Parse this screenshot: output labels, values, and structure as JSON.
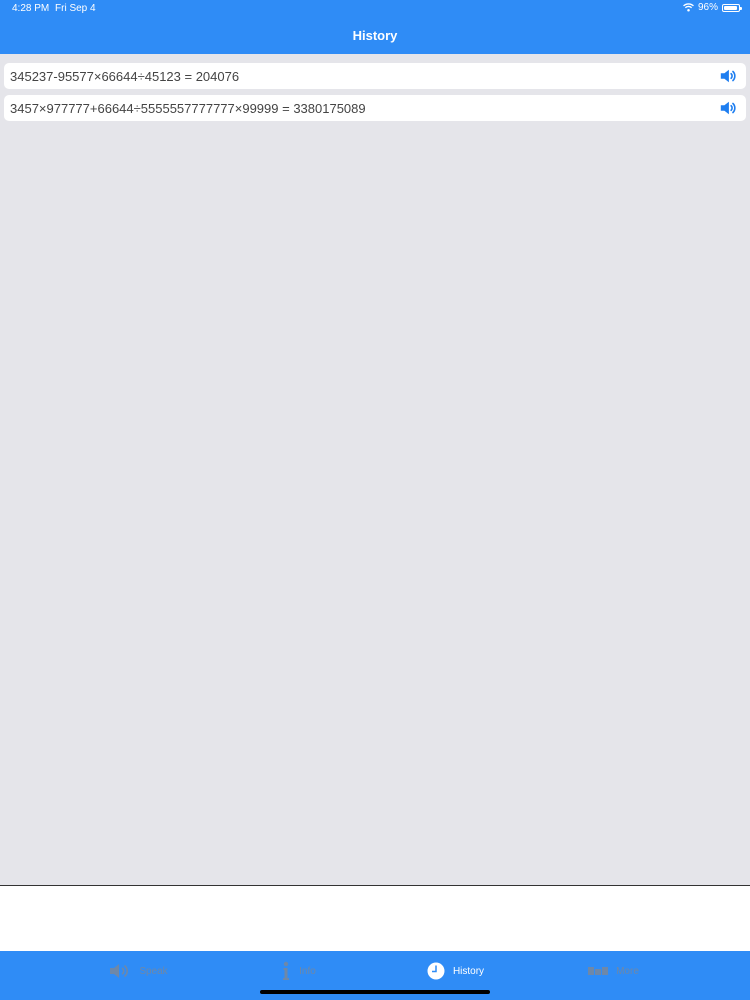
{
  "status_bar": {
    "time": "4:28 PM",
    "date": "Fri Sep 4",
    "battery": "96%",
    "battery_level": 0.96
  },
  "nav": {
    "title": "History"
  },
  "history": [
    {
      "expression": "345237-95577×66644÷45123 = 204076",
      "icon": "speaker-icon"
    },
    {
      "expression": "3457×977777+66644÷5555557777777×99999 = 3380175089",
      "icon": "speaker-icon"
    }
  ],
  "tabs": [
    {
      "label": "Speak",
      "icon": "speaker-icon",
      "active": false
    },
    {
      "label": "Info",
      "icon": "info-icon",
      "active": false
    },
    {
      "label": "History",
      "icon": "clock-icon",
      "active": true
    },
    {
      "label": "More",
      "icon": "more-icon",
      "active": false
    }
  ],
  "colors": {
    "accent": "#2f8cf6",
    "background": "#e5e5ea",
    "speaker_icon": "#1e7ef0"
  }
}
